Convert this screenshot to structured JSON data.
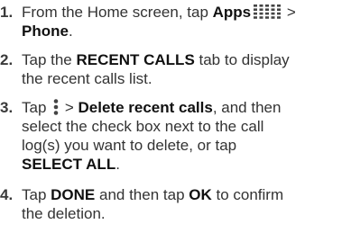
{
  "steps": [
    {
      "number": "1.",
      "line1_pre": "From the Home screen, tap ",
      "line1_bold": "Apps",
      "line1_post": " >",
      "apps_icon": "apps-grid-icon",
      "line2_bold": "Phone",
      "line2_post": "."
    },
    {
      "number": "2.",
      "line1_pre": "Tap the ",
      "line1_bold": "RECENT CALLS",
      "line1_post": " tab to display",
      "line2": "the recent calls list."
    },
    {
      "number": "3.",
      "line1_pre": "Tap ",
      "more_icon": "more-options-icon",
      "line1_mid": " > ",
      "line1_bold": "Delete recent calls",
      "line1_post": ", and then",
      "line2": "select the check box next to the call",
      "line3": "log(s) you want to delete, or tap",
      "line4_bold": "SELECT ALL",
      "line4_post": "."
    },
    {
      "number": "4.",
      "line1_pre": "Tap ",
      "line1_bold1": "DONE",
      "line1_mid": " and then tap ",
      "line1_bold2": "OK",
      "line1_post": " to confirm",
      "line2": "the deletion."
    }
  ],
  "colors": {
    "text": "#333333",
    "bold_text": "#111111",
    "icon": "#444444"
  }
}
